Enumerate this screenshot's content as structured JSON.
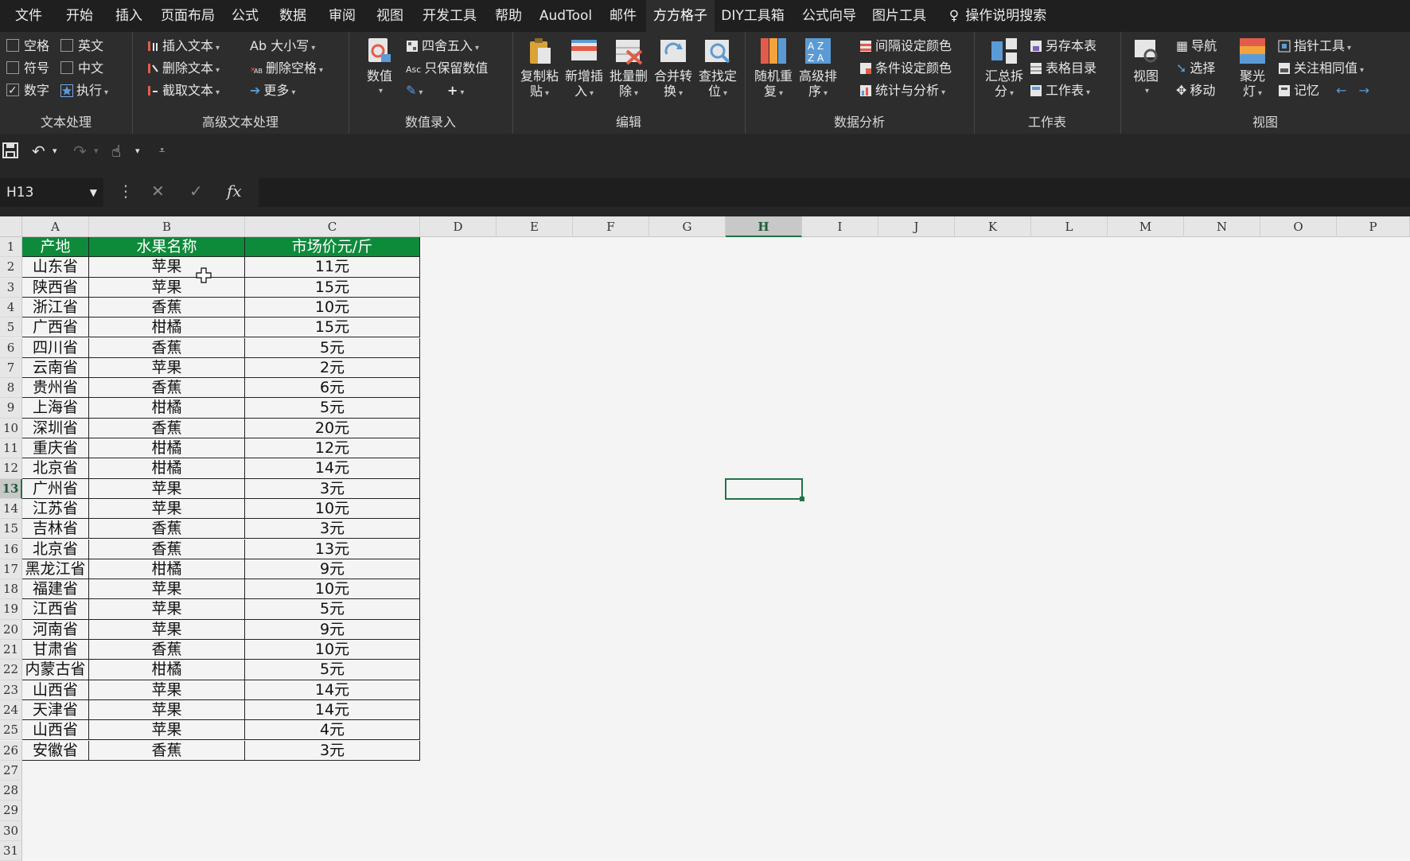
{
  "menu": {
    "tabs": [
      "文件",
      "开始",
      "插入",
      "页面布局",
      "公式",
      "数据",
      "审阅",
      "视图",
      "开发工具",
      "帮助",
      "AudTool",
      "邮件",
      "方方格子",
      "DIY工具箱",
      "公式向导",
      "图片工具",
      "操作说明搜索"
    ],
    "active": "方方格子"
  },
  "ribbon": {
    "text_processing": {
      "label": "文本处理",
      "items": [
        {
          "label": "空格",
          "checked": false
        },
        {
          "label": "英文",
          "checked": false
        },
        {
          "label": "符号",
          "checked": false
        },
        {
          "label": "中文",
          "checked": false
        },
        {
          "label": "数字",
          "checked": true
        },
        {
          "label": "执行"
        }
      ]
    },
    "advanced_text": {
      "label": "高级文本处理",
      "items": [
        "插入文本",
        "Ab 大小写",
        "删除文本",
        "删除空格",
        "截取文本",
        "更多"
      ]
    },
    "data_entry": {
      "label": "数值录入",
      "big": "数值",
      "items": [
        "四舍五入",
        "只保留数值"
      ]
    },
    "edit": {
      "label": "编辑",
      "buttons": [
        {
          "line1": "复制粘",
          "line2": "贴"
        },
        {
          "line1": "新增插",
          "line2": "入"
        },
        {
          "line1": "批量删",
          "line2": "除"
        },
        {
          "line1": "合并转",
          "line2": "换"
        },
        {
          "line1": "查找定",
          "line2": "位"
        }
      ]
    },
    "analysis": {
      "label": "数据分析",
      "buttons": [
        {
          "line1": "随机重",
          "line2": "复"
        },
        {
          "line1": "高级排",
          "line2": "序"
        }
      ],
      "items": [
        "间隔设定颜色",
        "条件设定颜色",
        "统计与分析"
      ]
    },
    "worksheet": {
      "label": "工作表",
      "big": {
        "line1": "汇总拆",
        "line2": "分"
      },
      "items": [
        "另存本表",
        "表格目录",
        "工作表"
      ]
    },
    "view": {
      "label": "视图",
      "big1": "视图",
      "items": [
        "导航",
        "选择",
        "移动"
      ],
      "big2": {
        "line1": "聚光",
        "line2": "灯"
      },
      "items2": [
        "指针工具",
        "关注相同值",
        "记忆"
      ]
    }
  },
  "formula_bar": {
    "name_box": "H13",
    "fx": "fx",
    "value": ""
  },
  "sheet": {
    "columns": [
      "A",
      "B",
      "C",
      "D",
      "E",
      "F",
      "G",
      "H",
      "I",
      "J",
      "K",
      "L",
      "M",
      "N",
      "O",
      "P"
    ],
    "selected_column": "H",
    "selected_row": "13",
    "row_numbers": [
      "1",
      "2",
      "3",
      "4",
      "5",
      "6",
      "7",
      "8",
      "9",
      "10",
      "11",
      "12",
      "13",
      "14",
      "15",
      "16",
      "17",
      "18",
      "19",
      "20",
      "21",
      "22",
      "23",
      "24",
      "25",
      "26",
      "27",
      "28",
      "29",
      "30",
      "31"
    ],
    "header": [
      "产地",
      "水果名称",
      "市场价元/斤"
    ],
    "rows": [
      [
        "山东省",
        "苹果",
        "11元"
      ],
      [
        "陕西省",
        "苹果",
        "15元"
      ],
      [
        "浙江省",
        "香蕉",
        "10元"
      ],
      [
        "广西省",
        "柑橘",
        "15元"
      ],
      [
        "四川省",
        "香蕉",
        "5元"
      ],
      [
        "云南省",
        "苹果",
        "2元"
      ],
      [
        "贵州省",
        "香蕉",
        "6元"
      ],
      [
        "上海省",
        "柑橘",
        "5元"
      ],
      [
        "深圳省",
        "香蕉",
        "20元"
      ],
      [
        "重庆省",
        "柑橘",
        "12元"
      ],
      [
        "北京省",
        "柑橘",
        "14元"
      ],
      [
        "广州省",
        "苹果",
        "3元"
      ],
      [
        "江苏省",
        "苹果",
        "10元"
      ],
      [
        "吉林省",
        "香蕉",
        "3元"
      ],
      [
        "北京省",
        "香蕉",
        "13元"
      ],
      [
        "黑龙江省",
        "柑橘",
        "9元"
      ],
      [
        "福建省",
        "苹果",
        "10元"
      ],
      [
        "江西省",
        "苹果",
        "5元"
      ],
      [
        "河南省",
        "苹果",
        "9元"
      ],
      [
        "甘肃省",
        "香蕉",
        "10元"
      ],
      [
        "内蒙古省",
        "柑橘",
        "5元"
      ],
      [
        "山西省",
        "苹果",
        "14元"
      ],
      [
        "天津省",
        "苹果",
        "14元"
      ],
      [
        "山西省",
        "苹果",
        "4元"
      ],
      [
        "安徽省",
        "香蕉",
        "3元"
      ]
    ]
  },
  "colors": {
    "header_fill": "#0e8a3b",
    "selection": "#217346"
  }
}
